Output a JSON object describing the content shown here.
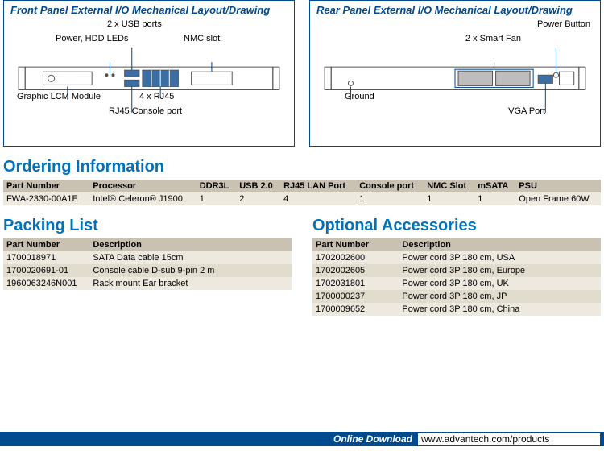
{
  "panels": {
    "front": {
      "title": "Front Panel External I/O Mechanical Layout/Drawing",
      "labels": {
        "usb": "2 x USB ports",
        "leds": "Power, HDD LEDs",
        "nmc": "NMC slot",
        "lcm": "Graphic LCM Module",
        "rj45": "4 x RJ45",
        "console": "RJ45 Console port"
      }
    },
    "rear": {
      "title": "Rear Panel External I/O Mechanical Layout/Drawing",
      "labels": {
        "power": "Power Button",
        "fan": "2 x Smart Fan",
        "ground": "Ground",
        "vga": "VGA Port"
      }
    }
  },
  "ordering": {
    "heading": "Ordering Information",
    "headers": [
      "Part Number",
      "Processor",
      "DDR3L",
      "USB 2.0",
      "RJ45 LAN Port",
      "Console port",
      "NMC Slot",
      "mSATA",
      "PSU"
    ],
    "rows": [
      [
        "FWA-2330-00A1E",
        "Intel® Celeron® J1900",
        "1",
        "2",
        "4",
        "1",
        "1",
        "1",
        "Open Frame 60W"
      ]
    ]
  },
  "packing": {
    "heading": "Packing List",
    "headers": [
      "Part Number",
      "Description"
    ],
    "rows": [
      [
        "1700018971",
        "SATA Data cable 15cm"
      ],
      [
        "1700020691-01",
        "Console cable D-sub 9-pin 2 m"
      ],
      [
        "1960063246N001",
        "Rack mount Ear bracket"
      ]
    ]
  },
  "accessories": {
    "heading": "Optional Accessories",
    "headers": [
      "Part Number",
      "Description"
    ],
    "rows": [
      [
        "1702002600",
        "Power cord 3P 180 cm, USA"
      ],
      [
        "1702002605",
        "Power cord 3P 180 cm, Europe"
      ],
      [
        "1702031801",
        "Power cord 3P 180 cm, UK"
      ],
      [
        "1700000237",
        "Power cord 3P 180 cm, JP"
      ],
      [
        "1700009652",
        "Power cord 3P 180 cm, China"
      ]
    ]
  },
  "footer": {
    "label": "Online Download",
    "url": "www.advantech.com/products"
  }
}
